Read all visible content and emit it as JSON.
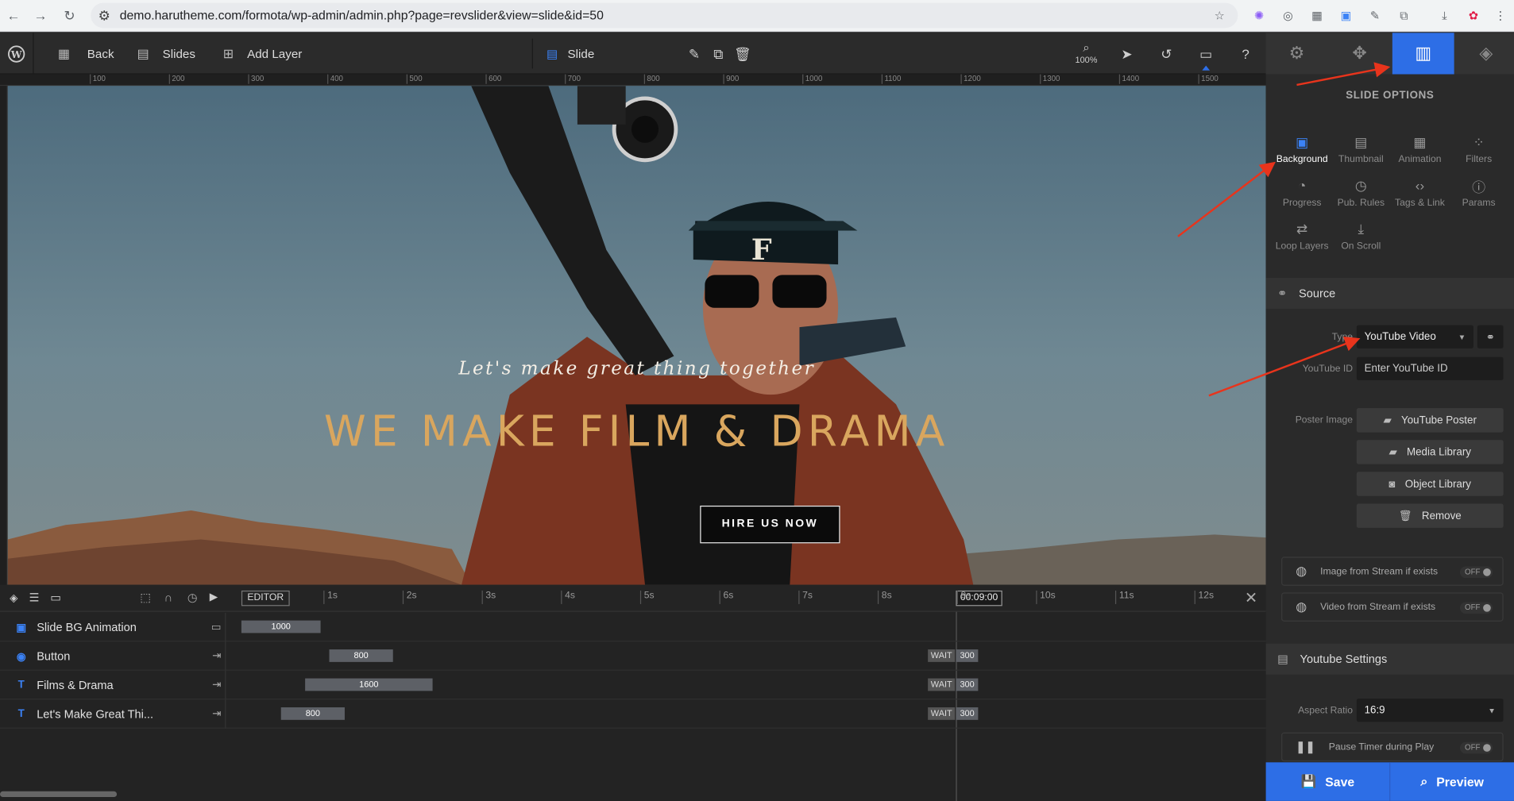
{
  "browser": {
    "url": "demo.harutheme.com/formota/wp-admin/admin.php?page=revslider&view=slide&id=50",
    "nav_icons": [
      "back-arrow-icon",
      "forward-arrow-icon",
      "reload-icon",
      "site-settings-icon"
    ]
  },
  "toolbar": {
    "back_label": "Back",
    "slides_label": "Slides",
    "add_layer_label": "Add Layer",
    "slide_label": "Slide",
    "zoom": "100%"
  },
  "ruler": {
    "ticks": [
      "100",
      "200",
      "300",
      "400",
      "500",
      "600",
      "700",
      "800",
      "900",
      "1000",
      "1100",
      "1200",
      "1300",
      "1400",
      "1500"
    ]
  },
  "canvas": {
    "tagline": "Let's make great thing together",
    "headline": "WE MAKE FILM & DRAMA",
    "button": "HIRE US NOW",
    "headline_color": "#d9a65e"
  },
  "timeline": {
    "editor_label": "EDITOR",
    "current_time": "00:09:00",
    "seconds": [
      "1s",
      "2s",
      "3s",
      "4s",
      "5s",
      "6s",
      "7s",
      "8s",
      "9s",
      "10s",
      "11s",
      "12s"
    ],
    "rows": [
      {
        "name": "Slide BG Animation",
        "bar": "1000"
      },
      {
        "name": "Button",
        "bar": "800",
        "wait": "WAIT",
        "wait_val": "300"
      },
      {
        "name": "Films & Drama",
        "bar": "1600",
        "wait": "WAIT",
        "wait_val": "300"
      },
      {
        "name": "Let's Make Great Thi...",
        "bar": "800",
        "wait": "WAIT",
        "wait_val": "300"
      }
    ]
  },
  "panel": {
    "title": "SLIDE OPTIONS",
    "options": [
      "Background",
      "Thumbnail",
      "Animation",
      "Filters",
      "Progress",
      "Pub. Rules",
      "Tags & Link",
      "Params",
      "Loop Layers",
      "On Scroll"
    ],
    "source_header": "Source",
    "type_label": "Type",
    "type_value": "YouTube Video",
    "youtube_id_label": "YouTube ID",
    "youtube_id_placeholder": "Enter YouTube ID",
    "poster_label": "Poster Image",
    "poster_buttons": [
      "YouTube Poster",
      "Media Library",
      "Object Library",
      "Remove"
    ],
    "stream_image": "Image from Stream if exists",
    "stream_video": "Video from Stream if exists",
    "off": "OFF",
    "youtube_settings_header": "Youtube Settings",
    "aspect_label": "Aspect Ratio",
    "aspect_value": "16:9",
    "pause_timer": "Pause Timer during Play",
    "accent_color": "#2d6ee6"
  },
  "footer": {
    "save": "Save",
    "preview": "Preview"
  }
}
